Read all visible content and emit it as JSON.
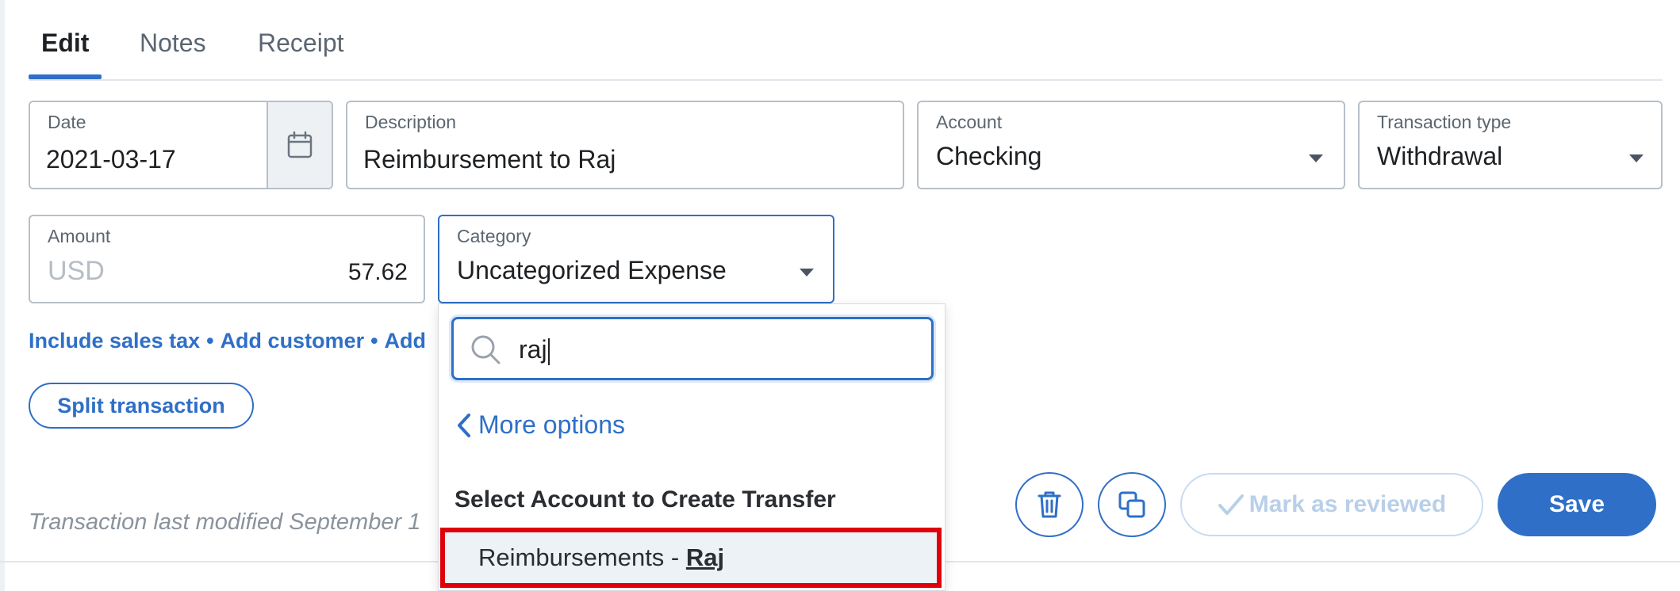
{
  "tabs": [
    {
      "label": "Edit",
      "active": true
    },
    {
      "label": "Notes",
      "active": false
    },
    {
      "label": "Receipt",
      "active": false
    }
  ],
  "form": {
    "date": {
      "label": "Date",
      "value": "2021-03-17"
    },
    "description": {
      "label": "Description",
      "value": "Reimbursement to Raj"
    },
    "account": {
      "label": "Account",
      "value": "Checking"
    },
    "transaction_type": {
      "label": "Transaction type",
      "value": "Withdrawal"
    },
    "amount": {
      "label": "Amount",
      "currency": "USD",
      "value": "57.62"
    },
    "category": {
      "label": "Category",
      "value": "Uncategorized Expense"
    }
  },
  "links": {
    "include_sales_tax": "Include sales tax",
    "add_customer": "Add customer",
    "add_partial": "Add",
    "separator": "•"
  },
  "split_transaction": "Split transaction",
  "modified_text": "Transaction last modified September 1",
  "actions": {
    "mark_reviewed": "Mark as reviewed",
    "save": "Save"
  },
  "category_dropdown": {
    "search_value": "raj",
    "more_options": "More options",
    "section_heading": "Select Account to Create Transfer",
    "option_prefix": "Reimbursements - ",
    "option_match": "Raj"
  },
  "colors": {
    "accent": "#2f6fc7",
    "highlight_border": "#e0000b",
    "muted_text": "#8a939c"
  },
  "icons": [
    "calendar-icon",
    "chevron-down-icon",
    "search-icon",
    "chevron-left-icon",
    "trash-icon",
    "duplicate-icon",
    "checkmark-icon"
  ]
}
